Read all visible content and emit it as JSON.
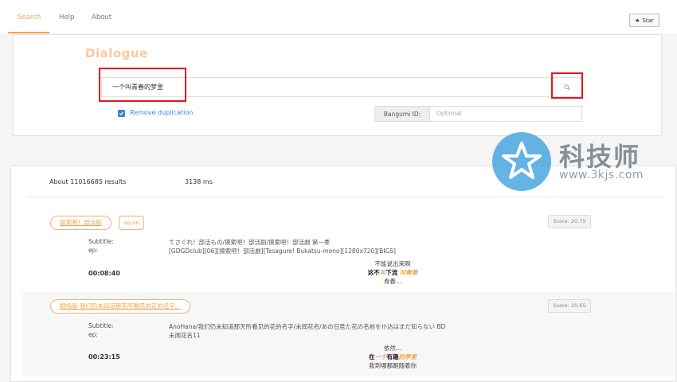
{
  "nav": {
    "tabs": [
      {
        "label": "Search",
        "active": true
      },
      {
        "label": "Help",
        "active": false
      },
      {
        "label": "About",
        "active": false
      }
    ],
    "star_label": "Star"
  },
  "search": {
    "logo_text": "Dialogue",
    "query": "一个叫青春的梦里",
    "remove_duplication_label": "Remove duplication",
    "remove_duplication_checked": true,
    "bangumi_label": "Bangumi ID:",
    "bangumi_placeholder": "Optional"
  },
  "watermark": {
    "text": "科技师",
    "url": "www.3kjs.com"
  },
  "results": {
    "count_text": "About 11016685 results",
    "time_text": "3138 ms",
    "items": [
      {
        "title": "摇索吧！部活剧",
        "ep_badge": "ep.06",
        "score": "Score: 20.75",
        "subtitle_label": "Subtitle:",
        "subtitle": "てさぐれ！部活もの/摸索吧！部活剧/摸索吧！部活劇 第一季",
        "ep_label": "ep:",
        "ep": "[GDGDclub][06][摸索吧！部活劇][Tesagure! Bukatsu-mono][1280x720][BIG5]",
        "time": "00:08:40",
        "ctx_before": "不能说出来啊",
        "ctx_main_a": "这不",
        "ctx_main_hl1": "叫",
        "ctx_main_b": "下流 ",
        "ctx_main_hl2": "叫青春",
        "ctx_after": "青春..."
      },
      {
        "title": "剧场版 我们仍未知道那天所看见的花的名字。",
        "ep_badge": "",
        "score": "Score: 20.65",
        "subtitle_label": "Subtitle:",
        "subtitle": "AnoHana/我们仍未知道那天所看见的花的名字/未闻花名/あの日見た花の名前を仆达はまだ知らない BD",
        "ep_label": "ep:",
        "ep": "未闻花名11",
        "time": "00:23:15",
        "ctx_before": "依然...",
        "ctx_main_a": "在",
        "ctx_main_hl1": "一个",
        "ctx_main_b": "有趣",
        "ctx_main_hl2": "的梦里",
        "ctx_after": "我到哪都跟随着你"
      }
    ]
  }
}
